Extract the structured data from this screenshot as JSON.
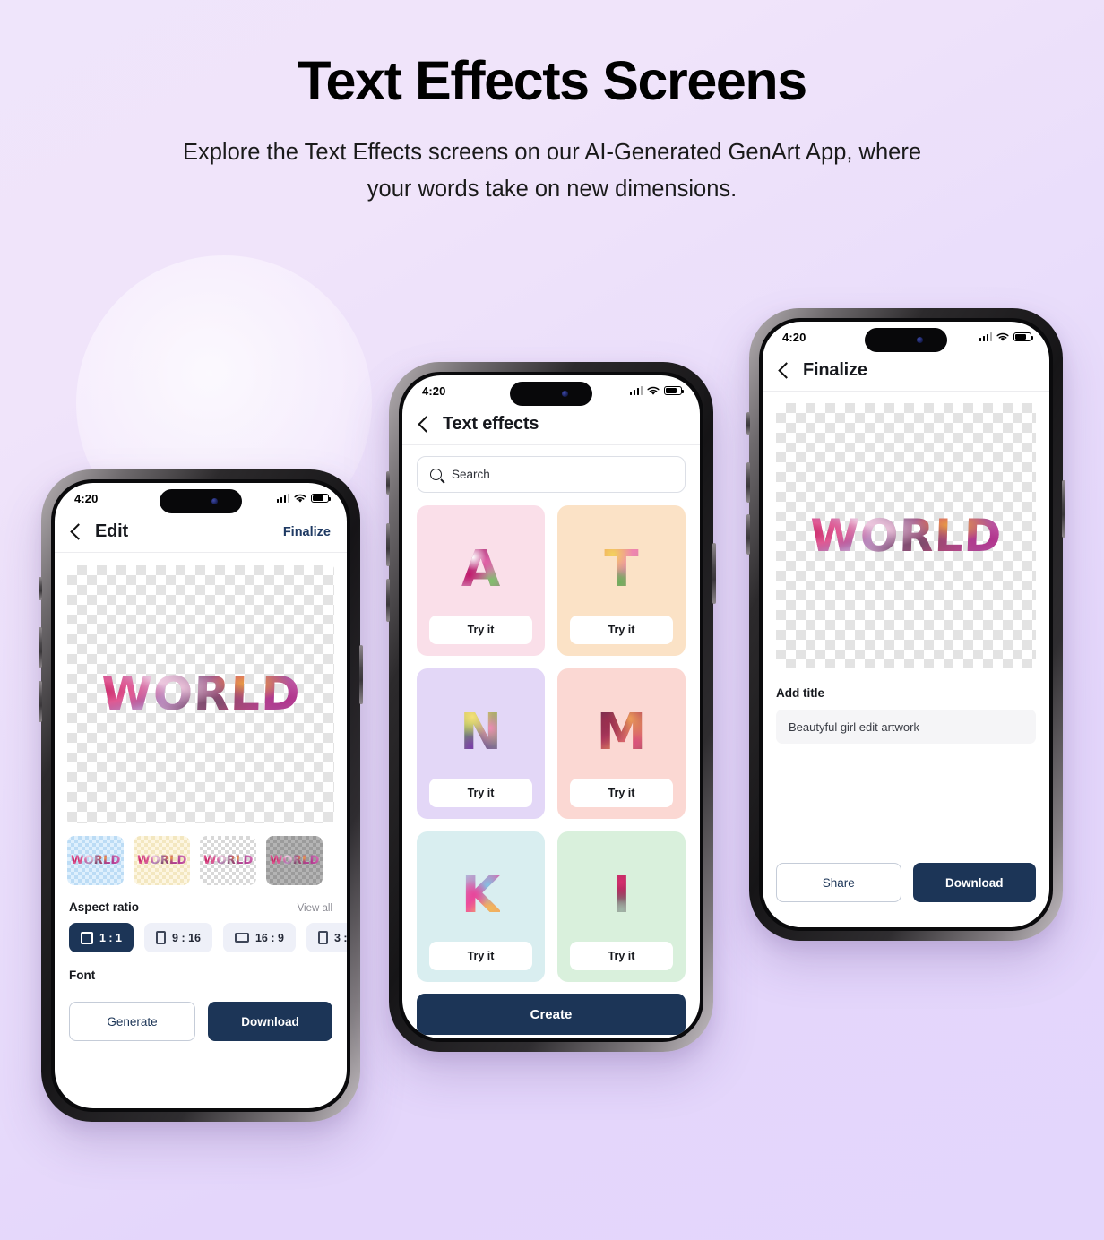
{
  "header": {
    "title": "Text Effects Screens",
    "subtitle": "Explore the Text Effects screens on our AI-Generated GenArt App, where your words take on new dimensions."
  },
  "colors": {
    "background_start": "#efe5fb",
    "background_end": "#e3d6fc",
    "primary": "#1c3557",
    "accent_link": "#1f3a63",
    "chip_idle": "#eef0f8",
    "input_fill": "#f5f5f7"
  },
  "phones": [
    {
      "id": "edit",
      "status_bar": {
        "time": "4:20",
        "cellular": "cellular-icon",
        "wifi": "wifi-icon",
        "battery": "battery-icon"
      },
      "nav": {
        "back": "chevron-left-icon",
        "title": "Edit",
        "action": "Finalize"
      },
      "canvas": {
        "word": "WORLD",
        "background": "transparent-checkerboard"
      },
      "thumbnails": [
        {
          "label": "WORLD",
          "style": "blue-checker"
        },
        {
          "label": "WORLD",
          "style": "cream-checker"
        },
        {
          "label": "WORLD",
          "style": "light-checker"
        },
        {
          "label": "WORLD",
          "style": "gray-checker"
        }
      ],
      "aspect_ratio": {
        "label": "Aspect ratio",
        "view_all": "View all",
        "options": [
          {
            "label": "1 : 1",
            "selected": true,
            "shape": "square"
          },
          {
            "label": "9 : 16",
            "selected": false,
            "shape": "portrait"
          },
          {
            "label": "16 : 9",
            "selected": false,
            "shape": "landscape"
          },
          {
            "label": "3 :",
            "selected": false,
            "shape": "portrait"
          }
        ]
      },
      "font_label": "Font",
      "actions": {
        "secondary": "Generate",
        "primary": "Download"
      }
    },
    {
      "id": "text-effects",
      "status_bar": {
        "time": "4:20",
        "cellular": "cellular-icon",
        "wifi": "wifi-icon",
        "battery": "battery-icon"
      },
      "nav": {
        "back": "chevron-left-icon",
        "title": "Text effects"
      },
      "search": {
        "placeholder": "Search",
        "icon": "search-icon"
      },
      "effects": [
        {
          "letter": "A",
          "card_color": "#fadfe9",
          "cta": "Try it"
        },
        {
          "letter": "T",
          "card_color": "#fbe2c6",
          "cta": "Try it"
        },
        {
          "letter": "N",
          "card_color": "#e3d7f7",
          "cta": "Try it"
        },
        {
          "letter": "M",
          "card_color": "#fbd8d3",
          "cta": "Try it"
        },
        {
          "letter": "K",
          "card_color": "#d9eef0",
          "cta": "Try it"
        },
        {
          "letter": "I",
          "card_color": "#d9f0dc",
          "cta": "Try it"
        }
      ],
      "create_label": "Create"
    },
    {
      "id": "finalize",
      "status_bar": {
        "time": "4:20",
        "cellular": "cellular-icon",
        "wifi": "wifi-icon",
        "battery": "battery-icon"
      },
      "nav": {
        "back": "chevron-left-icon",
        "title": "Finalize"
      },
      "canvas": {
        "word": "WORLD",
        "background": "transparent-checkerboard"
      },
      "title_section": {
        "label": "Add title",
        "value": "Beautyful girl edit artwork"
      },
      "actions": {
        "secondary": "Share",
        "primary": "Download"
      }
    }
  ]
}
